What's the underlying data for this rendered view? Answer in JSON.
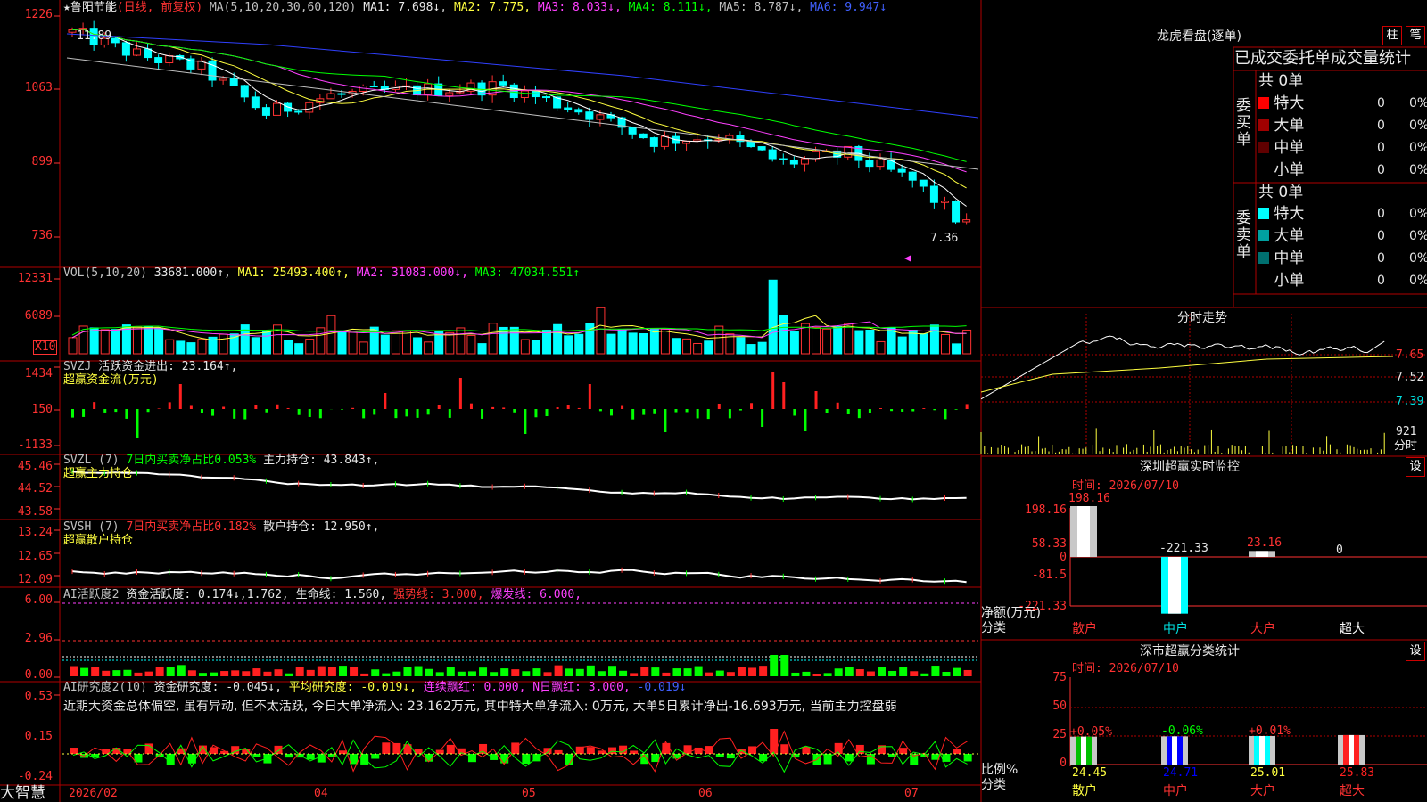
{
  "app": {
    "brand": "大智慧"
  },
  "main": {
    "star": "★",
    "stock_name": "鲁阳节能",
    "period": "(日线, 前复权)",
    "ma_params": "MA(5,10,20,30,60,120)",
    "ma1": "MA1: 7.698↓",
    "ma2": "MA2: 7.775,",
    "ma3": "MA3: 8.033↓,",
    "ma4": "MA4: 8.111↓,",
    "ma5": "MA5: 8.787↓,",
    "ma6": "MA6: 9.947↓",
    "y_ticks": [
      "1226",
      "1063",
      "899",
      "736"
    ],
    "high_label": "11.89",
    "low_label": "7.36"
  },
  "vol": {
    "head": "VOL(5,10,20)",
    "val": "33681.000↑,",
    "ma1": "MA1: 25493.400↑,",
    "ma2": "MA2: 31083.000↓,",
    "ma3": "MA3: 47034.551↑",
    "y_ticks": [
      "12331",
      "6089"
    ],
    "unit": "X10"
  },
  "svzj": {
    "head": "SVZJ",
    "title": "活跃资金进出: 23.164↑,",
    "subtitle": "超赢资金流(万元)",
    "y_ticks": [
      "1434",
      "150",
      "-1133"
    ]
  },
  "svzl": {
    "head": "SVZL (7)",
    "t1": "7日内买卖净占比0.053%",
    "t2": "主力持仓: 43.843↑,",
    "subtitle": "超赢主力持仓",
    "y_ticks": [
      "45.46",
      "44.52",
      "43.58"
    ]
  },
  "svsh": {
    "head": "SVSH (7)",
    "t1": "7日内买卖净占比0.182%",
    "t2": "散户持仓: 12.950↑,",
    "subtitle": "超赢散户持仓",
    "y_ticks": [
      "13.24",
      "12.65",
      "12.09"
    ]
  },
  "ai1": {
    "head": "AI活跃度2",
    "t1": "资金活跃度: 0.174↓,",
    "t2": "1.762,",
    "t3": "生命线: 1.560,",
    "t4": "强势线: 3.000,",
    "t5": "爆发线: 6.000,",
    "y_ticks": [
      "6.00",
      "2.96",
      "0.00"
    ]
  },
  "ai2": {
    "head": "AI研究度2(10)",
    "t1": "资金研究度: -0.045↓,",
    "t2": "平均研究度: -0.019↓,",
    "t3": "连续飘红: 0.000,",
    "t4": "N日飘红: 3.000,",
    "t5": "-0.019↓",
    "desc": "近期大资金总体偏空, 虽有异动, 但不太活跃, 今日大单净流入: 23.162万元, 其中特大单净流入: 0万元, 大单5日累计净出-16.693万元, 当前主力控盘弱",
    "y_ticks": [
      "0.53",
      "0.15",
      "-0.24"
    ]
  },
  "dates": [
    "2026/02",
    "04",
    "05",
    "06",
    "07"
  ],
  "lhb": {
    "title": "龙虎看盘(逐单)",
    "btn1": "柱",
    "btn2": "笔",
    "header": "已成交委托单成交量统计",
    "buy": {
      "label": "委买单",
      "total": "共 0单",
      "rows": [
        {
          "name": "特大",
          "v": "0",
          "p": "0%",
          "color": "#ff0000"
        },
        {
          "name": "大单",
          "v": "0",
          "p": "0%",
          "color": "#a00000"
        },
        {
          "name": "中单",
          "v": "0",
          "p": "0%",
          "color": "#600000"
        },
        {
          "name": "小单",
          "v": "0",
          "p": "0%",
          "color": "#000000"
        }
      ]
    },
    "sell": {
      "label": "委卖单",
      "total": "共 0单",
      "rows": [
        {
          "name": "特大",
          "v": "0",
          "p": "0%",
          "color": "#00ffff"
        },
        {
          "name": "大单",
          "v": "0",
          "p": "0%",
          "color": "#00a0a0"
        },
        {
          "name": "中单",
          "v": "0",
          "p": "0%",
          "color": "#007070"
        },
        {
          "name": "小单",
          "v": "0",
          "p": "0%",
          "color": "#000000"
        }
      ]
    }
  },
  "fenshi": {
    "title": "分时走势",
    "y_ticks": [
      "7.65",
      "7.52",
      "7.39"
    ],
    "vol": "921",
    "unit": "分时"
  },
  "monitor": {
    "title": "深圳超赢实时监控",
    "set": "设",
    "time": "时间: 2026/07/10",
    "y_ticks": [
      "198.16",
      "58.33",
      "0",
      "-81.5",
      "-221.33"
    ],
    "ylabel": "净额(万元)",
    "xlabel": "分类",
    "bars": [
      {
        "name": "散户",
        "value": 198.16,
        "label": "198.16"
      },
      {
        "name": "中户",
        "value": -221.33,
        "label": "-221.33"
      },
      {
        "name": "大户",
        "value": 23.16,
        "label": "23.16"
      },
      {
        "name": "超大",
        "value": 0,
        "label": "0"
      }
    ]
  },
  "classify": {
    "title": "深市超赢分类统计",
    "set": "设",
    "time": "时间: 2026/07/10",
    "y_ticks": [
      "75",
      "50",
      "25",
      "0"
    ],
    "ylabel": "比例%",
    "xlabel": "分类",
    "bars": [
      {
        "name": "散户",
        "value": 24.45,
        "pct": "+0.05%",
        "color": "#00c000"
      },
      {
        "name": "中户",
        "value": 24.71,
        "pct": "-0.06%",
        "color": "#0000ff"
      },
      {
        "name": "大户",
        "value": 25.01,
        "pct": "+0.01%",
        "color": "#00ffff"
      },
      {
        "name": "超大",
        "value": 25.83,
        "pct": "",
        "color": "#ff2020"
      }
    ]
  }
}
